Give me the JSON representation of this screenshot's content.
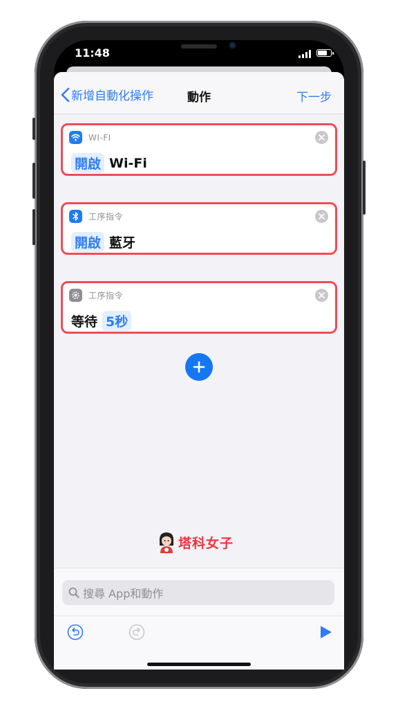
{
  "status_bar": {
    "time": "11:48",
    "battery_level": 0.8
  },
  "nav": {
    "back_label": "新增自動化操作",
    "title": "動作",
    "next_label": "下一步"
  },
  "actions": [
    {
      "app": "WI-FI",
      "icon": "wifi-icon",
      "icon_color": "#1f7cf5",
      "verb": "開啟",
      "object": "Wi-Fi"
    },
    {
      "app": "工序指令",
      "icon": "bluetooth-icon",
      "icon_color": "#1f7cf5",
      "verb": "開啟",
      "object": "藍牙"
    },
    {
      "app": "工序指令",
      "icon": "gear-icon",
      "icon_color": "#8e8e93",
      "label": "等待",
      "value": "5秒"
    }
  ],
  "watermark": "塔科女子",
  "search": {
    "placeholder": "搜尋 App和動作"
  },
  "colors": {
    "accent": "#2f7cf6",
    "highlight_border": "#ef4c56",
    "chip_bg": "#e3efff",
    "watermark": "#f0353d"
  }
}
